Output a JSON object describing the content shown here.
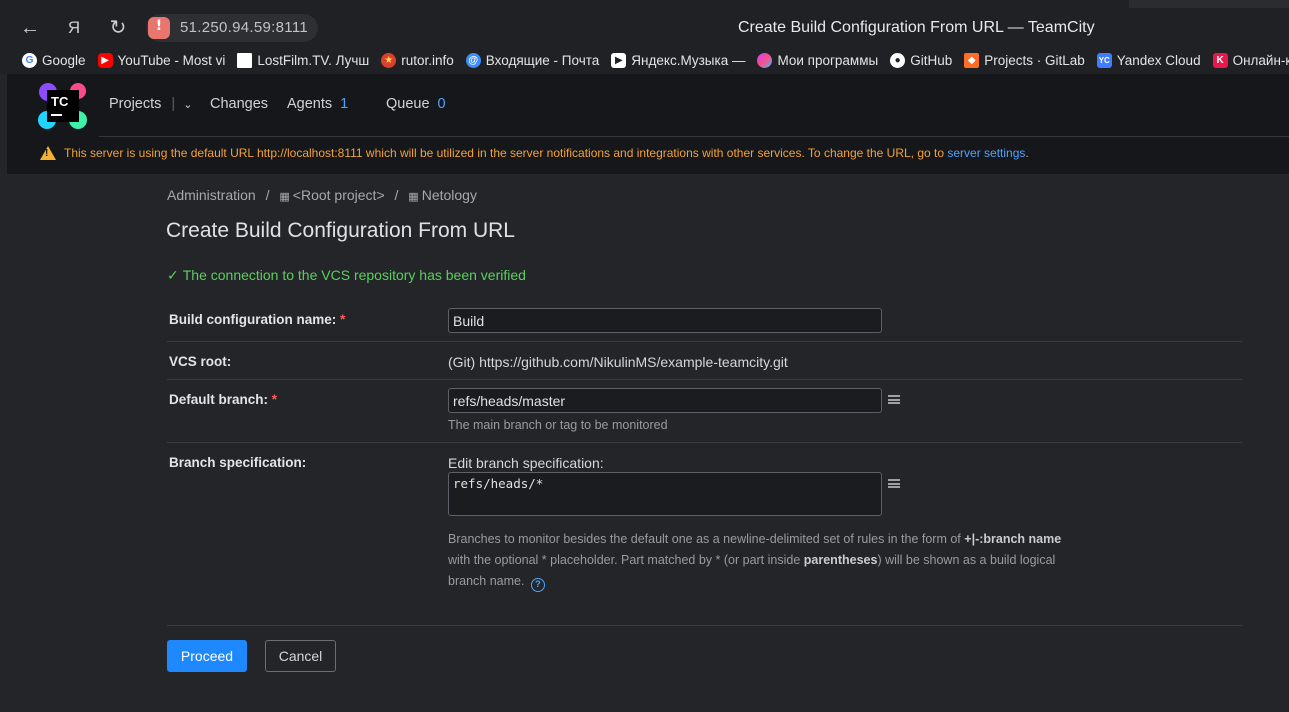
{
  "browser": {
    "url": "51.250.94.59:8111",
    "window_title": "Create Build Configuration From URL — TeamCity",
    "bookmarks": [
      {
        "label": "Google",
        "icon": "google-icon",
        "color": "#ffffff"
      },
      {
        "label": "YouTube - Most vi",
        "icon": "youtube-icon",
        "color": "#ff0000"
      },
      {
        "label": "LostFilm.TV. Лучш",
        "icon": "page-icon",
        "color": "#ffffff"
      },
      {
        "label": "rutor.info",
        "icon": "rutor-icon",
        "color": "#d9412e"
      },
      {
        "label": "Входящие - Почта",
        "icon": "mail-icon",
        "color": "#3f8cff"
      },
      {
        "label": "Яндекс.Музыка —",
        "icon": "play-icon",
        "color": "#ffffff"
      },
      {
        "label": "Мои программы",
        "icon": "programs-icon",
        "color": "#b44cff"
      },
      {
        "label": "GitHub",
        "icon": "github-icon",
        "color": "#ffffff"
      },
      {
        "label": "Projects · GitLab",
        "icon": "gitlab-icon",
        "color": "#fc6d26"
      },
      {
        "label": "Yandex Cloud",
        "icon": "yandex-cloud-icon",
        "color": "#3f7cff"
      },
      {
        "label": "Онлайн-кино",
        "icon": "kinopoisk-icon",
        "color": "#e8194a"
      }
    ]
  },
  "header": {
    "logo_text": "TC",
    "nav": {
      "projects": "Projects",
      "changes": "Changes",
      "agents": "Agents",
      "agents_count": "1",
      "queue": "Queue",
      "queue_count": "0"
    },
    "banner": {
      "text": "This server is using the default URL http://localhost:8111 which will be utilized in the server notifications and integrations with other services. To change the URL, go to",
      "link": "server settings",
      "end": "."
    }
  },
  "breadcrumb": {
    "admin": "Administration",
    "root": "<Root project>",
    "project": "Netology",
    "separator": "/"
  },
  "page": {
    "title": "Create Build Configuration From URL",
    "verified": "The connection to the VCS repository has been verified"
  },
  "form": {
    "name_label": "Build configuration name:",
    "name_value": "Build",
    "vcs_label": "VCS root:",
    "vcs_value": "(Git) https://github.com/NikulinMS/example-teamcity.git",
    "branch_label": "Default branch:",
    "branch_value": "refs/heads/master",
    "branch_hint": "The main branch or tag to be monitored",
    "spec_label": "Branch specification:",
    "spec_edit_label": "Edit branch specification:",
    "spec_value": "refs/heads/*",
    "spec_hint_1": "Branches to monitor besides the default one as a newline-delimited set of rules in the form of",
    "spec_hint_bold1": "+|-:branch name",
    "spec_hint_2": "with the optional * placeholder. Part matched by * (or part inside",
    "spec_hint_bold2": "parentheses",
    "spec_hint_3": ") will be shown as a build logical",
    "spec_hint_4": "branch name.",
    "required_mark": "*"
  },
  "buttons": {
    "proceed": "Proceed",
    "cancel": "Cancel"
  }
}
